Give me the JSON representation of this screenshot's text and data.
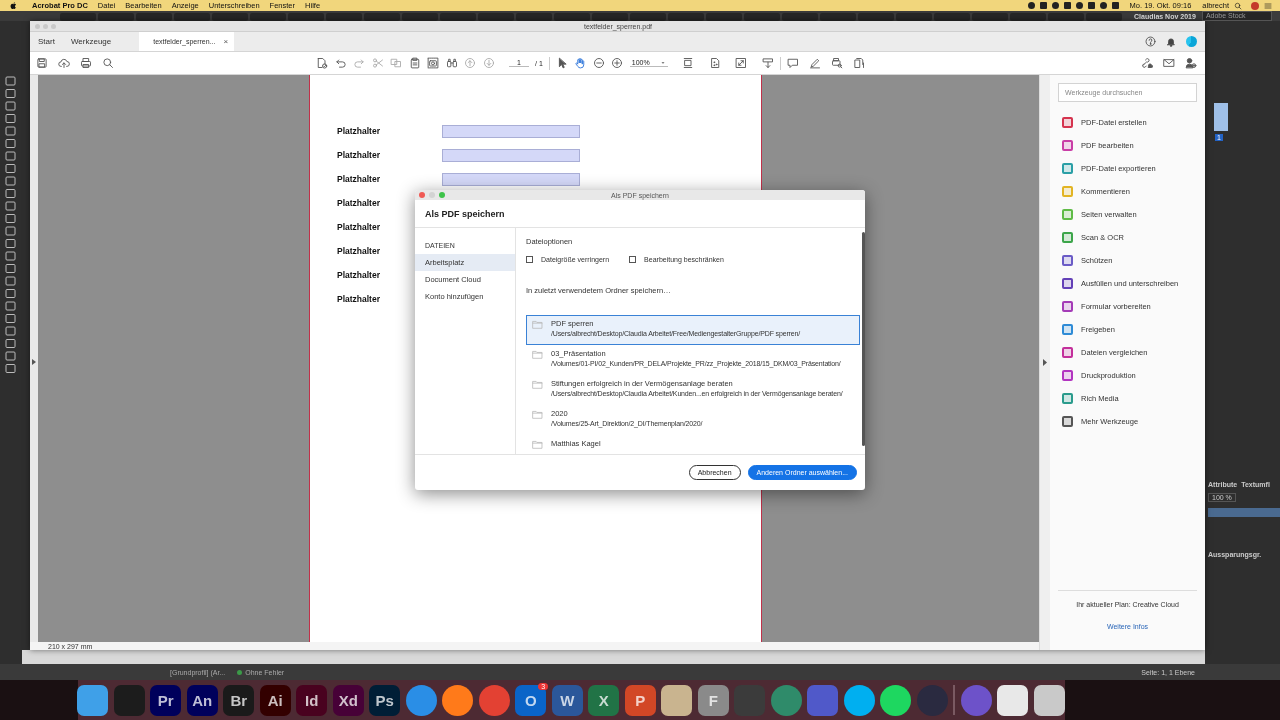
{
  "menubar": {
    "app": "Acrobat Pro DC",
    "menus": [
      "Datei",
      "Bearbeiten",
      "Anzeige",
      "Unterschreiben",
      "Fenster",
      "Hilfe"
    ],
    "clock": "Mo. 19. Okt. 09:16",
    "user": "albrecht"
  },
  "window": {
    "title": "textfelder_sperren.pdf",
    "tabs": [
      {
        "label": "Start",
        "selected": false,
        "kind": "nav"
      },
      {
        "label": "Werkzeuge",
        "selected": false,
        "kind": "nav"
      },
      {
        "label": "textfelder_sperren...",
        "selected": true,
        "kind": "document"
      }
    ],
    "close_glyph": "×"
  },
  "toolbar": {
    "page": "1",
    "page_total": "/ 1",
    "zoom": "100%"
  },
  "page": {
    "rows": [
      {
        "label": "Platzhalter",
        "field": {
          "kind": "text"
        }
      },
      {
        "label": "Platzhalter",
        "field": {
          "kind": "text"
        }
      },
      {
        "label": "Platzhalter",
        "field": {
          "kind": "text"
        }
      },
      {
        "label": "Platzhalter"
      },
      {
        "label": "Platzhalter"
      },
      {
        "label": "Platzhalter"
      },
      {
        "label": "Platzhalter"
      },
      {
        "label": "Platzhalter"
      }
    ],
    "size": "210 x 297 mm"
  },
  "tools_panel": {
    "search_placeholder": "Werkzeuge durchsuchen",
    "tools": [
      {
        "label": "PDF-Datei erstellen",
        "color": "#d5334e"
      },
      {
        "label": "PDF bearbeiten",
        "color": "#c93da6"
      },
      {
        "label": "PDF-Datei exportieren",
        "color": "#2a9fa6"
      },
      {
        "label": "Kommentieren",
        "color": "#e2b423"
      },
      {
        "label": "Seiten verwalten",
        "color": "#5fbb46"
      },
      {
        "label": "Scan & OCR",
        "color": "#3ca54a"
      },
      {
        "label": "Schützen",
        "color": "#6a5bc6"
      },
      {
        "label": "Ausfüllen und unterschreiben",
        "color": "#6340b7"
      },
      {
        "label": "Formular vorbereiten",
        "color": "#a43bb7"
      },
      {
        "label": "Freigeben",
        "color": "#2e8bd6"
      },
      {
        "label": "Dateien vergleichen",
        "color": "#c32f9b"
      },
      {
        "label": "Druckproduktion",
        "color": "#b234c0"
      },
      {
        "label": "Rich Media",
        "color": "#2a9b8c"
      },
      {
        "label": "Mehr Werkzeuge",
        "color": "#555555"
      }
    ],
    "plan": "Ihr aktueller Plan: Creative Cloud",
    "link": "Weitere Infos"
  },
  "dialog": {
    "title": "Als PDF speichern",
    "heading": "Als PDF speichern",
    "section": "DATEIEN",
    "nav": [
      {
        "label": "Arbeitsplatz",
        "selected": true
      },
      {
        "label": "Document Cloud",
        "selected": false
      },
      {
        "label": "Konto hinzufügen",
        "selected": false
      }
    ],
    "options_title": "Dateioptionen",
    "options": [
      {
        "label": "Dateigröße verringern",
        "checked": false
      },
      {
        "label": "Bearbeitung beschränken",
        "checked": false
      }
    ],
    "recent_title": "In zuletzt verwendetem Ordner speichern…",
    "folders": [
      {
        "name": "PDF sperren",
        "path": "/Users/albrecht/Desktop/Claudia Arbeitet/Free/MediengestalterGruppe/PDF sperren/",
        "selected": true
      },
      {
        "name": "03_Präsentation",
        "path": "/Volumes/01-PI/02_Kunden/PR_DELA/Projekte_PR/zz_Projekte_2018/15_DKM/03_Präsentation/",
        "selected": false
      },
      {
        "name": "Stiftungen erfolgreich in der Vermögensanlage beraten",
        "path": "/Users/albrecht/Desktop/Claudia Arbeitet/Kunden...en erfolgreich in der Vermögensanlage beraten/",
        "selected": false
      },
      {
        "name": "2020",
        "path": "/Volumes/25-Art_Direktion/2_DI/Themenplan/2020/",
        "selected": false
      },
      {
        "name": "Matthias Kagel",
        "selected": false
      }
    ],
    "buttons": [
      {
        "label": "Abbrechen",
        "kind": "secondary"
      },
      {
        "label": "Anderen Ordner auswählen...",
        "kind": "primary"
      }
    ]
  },
  "indesign": {
    "document_title": "Claudias Nov 2019",
    "stock_placeholder": "Adobe Stock",
    "page_badge": "1",
    "panel_tabs": [
      "Attribute",
      "Textumfl"
    ],
    "opacity": "100 %",
    "knockout": "Aussparungsgr.",
    "profile": "[Grundprofil] (Ar...",
    "preflight": "Ohne Fehler",
    "page_info": "Seite: 1, 1 Ebene"
  },
  "dock": [
    {
      "kind": "square",
      "color": "#3fa0e8"
    },
    {
      "kind": "square",
      "color": "#1c1c1c"
    },
    {
      "kind": "square",
      "color": "#00005b",
      "glyph": "Pr"
    },
    {
      "kind": "square",
      "color": "#00005b",
      "glyph": "An"
    },
    {
      "kind": "square",
      "color": "#1a1a1a",
      "glyph": "Br"
    },
    {
      "kind": "square",
      "color": "#330000",
      "glyph": "Ai"
    },
    {
      "kind": "square",
      "color": "#49021f",
      "glyph": "Id"
    },
    {
      "kind": "square",
      "color": "#470137",
      "glyph": "Xd"
    },
    {
      "kind": "square",
      "color": "#001e36",
      "glyph": "Ps"
    },
    {
      "kind": "circle",
      "color": "#2a8ee6"
    },
    {
      "kind": "circle",
      "color": "#ff7a1a"
    },
    {
      "kind": "circle",
      "color": "#e34133"
    },
    {
      "kind": "square",
      "color": "#0a64c8",
      "glyph": "O",
      "badge": "3"
    },
    {
      "kind": "square",
      "color": "#2b579a",
      "glyph": "W"
    },
    {
      "kind": "square",
      "color": "#217346",
      "glyph": "X"
    },
    {
      "kind": "square",
      "color": "#d24726",
      "glyph": "P"
    },
    {
      "kind": "square",
      "color": "#c9b48f"
    },
    {
      "kind": "square",
      "color": "#8a8a8a",
      "glyph": "F"
    },
    {
      "kind": "square",
      "color": "#3b3b3b"
    },
    {
      "kind": "circle",
      "color": "#2f8b6a"
    },
    {
      "kind": "square",
      "color": "#5059c9"
    },
    {
      "kind": "circle",
      "color": "#00aff0"
    },
    {
      "kind": "circle",
      "color": "#1ed760"
    },
    {
      "kind": "circle",
      "color": "#2a2a40"
    },
    {
      "kind": "separator",
      "color": "#7a5a62"
    },
    {
      "kind": "circle",
      "color": "#6d52c9"
    },
    {
      "kind": "square",
      "color": "#e8e8e8"
    },
    {
      "kind": "square",
      "color": "#c9c9c9"
    }
  ]
}
